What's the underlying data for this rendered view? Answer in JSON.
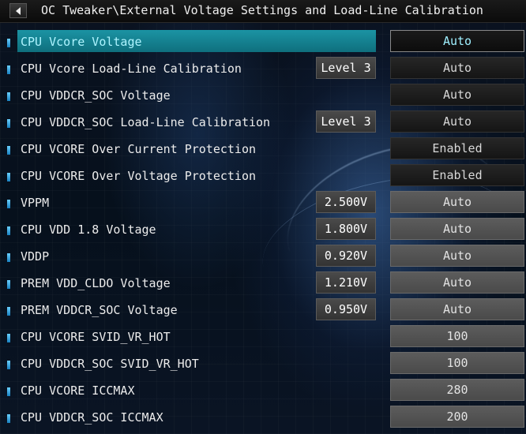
{
  "header": {
    "title": "OC Tweaker\\External Voltage Settings and Load-Line Calibration"
  },
  "rows": [
    {
      "label": "CPU Vcore Voltage",
      "mid": "",
      "value": "Auto"
    },
    {
      "label": "CPU Vcore Load-Line Calibration",
      "mid": "Level 3",
      "value": "Auto"
    },
    {
      "label": "CPU VDDCR_SOC Voltage",
      "mid": "",
      "value": "Auto"
    },
    {
      "label": "CPU VDDCR_SOC Load-Line Calibration",
      "mid": "Level 3",
      "value": "Auto"
    },
    {
      "label": "CPU VCORE Over Current Protection",
      "mid": "",
      "value": "Enabled"
    },
    {
      "label": "CPU VCORE Over Voltage Protection",
      "mid": "",
      "value": "Enabled"
    },
    {
      "label": "VPPM",
      "mid": "2.500V",
      "value": "Auto"
    },
    {
      "label": "CPU VDD 1.8 Voltage",
      "mid": "1.800V",
      "value": "Auto"
    },
    {
      "label": "VDDP",
      "mid": "0.920V",
      "value": "Auto"
    },
    {
      "label": "PREM VDD_CLDO Voltage",
      "mid": "1.210V",
      "value": "Auto"
    },
    {
      "label": "PREM VDDCR_SOC Voltage",
      "mid": "0.950V",
      "value": "Auto"
    },
    {
      "label": "CPU VCORE SVID_VR_HOT",
      "mid": "",
      "value": "100"
    },
    {
      "label": "CPU VDDCR_SOC SVID_VR_HOT",
      "mid": "",
      "value": "100"
    },
    {
      "label": "CPU VCORE ICCMAX",
      "mid": "",
      "value": "280"
    },
    {
      "label": "CPU VDDCR_SOC ICCMAX",
      "mid": "",
      "value": "200"
    }
  ]
}
